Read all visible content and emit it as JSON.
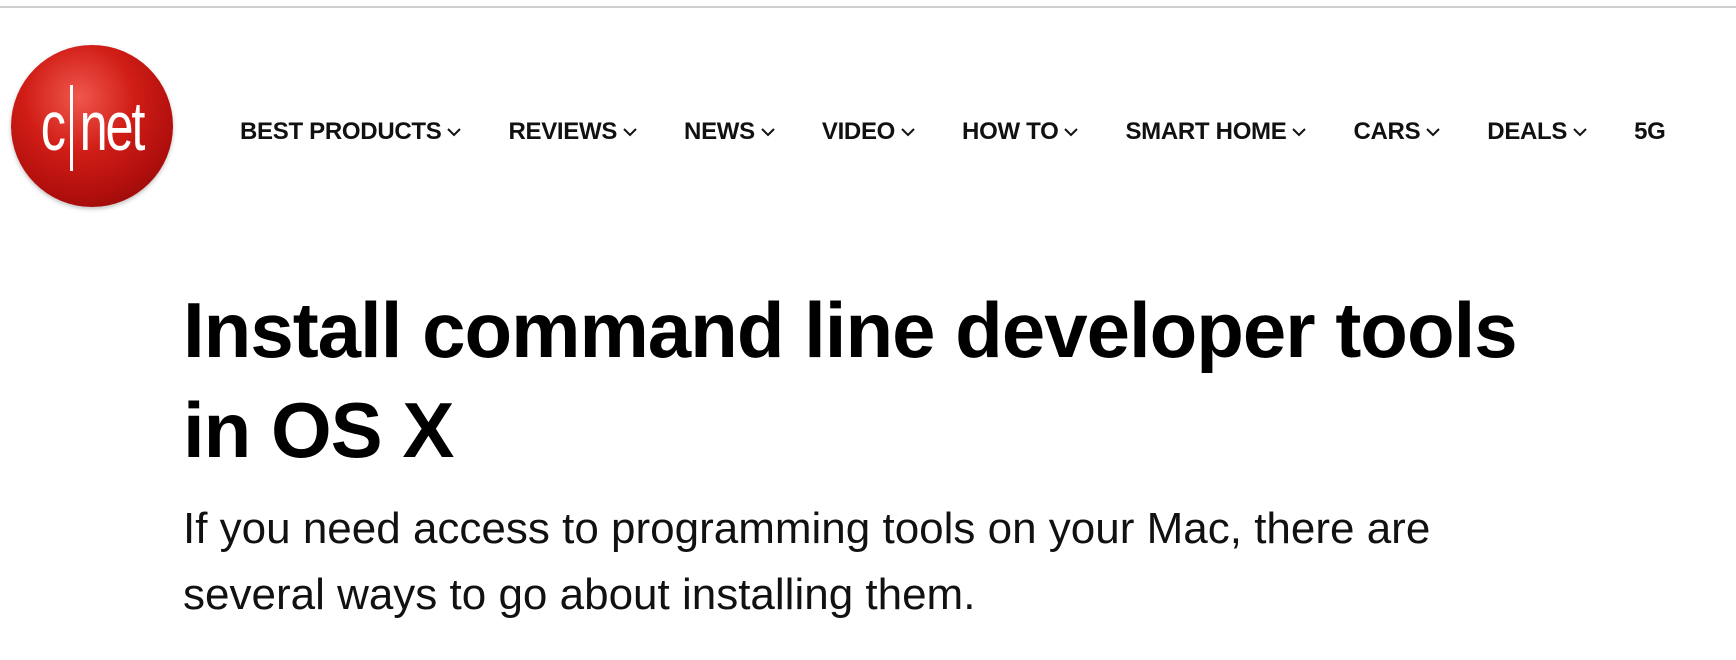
{
  "header": {
    "logo_text": "cnet",
    "logo_color": "#cc1a14",
    "nav": [
      {
        "label": "BEST PRODUCTS",
        "icon": "chevron-down-icon"
      },
      {
        "label": "REVIEWS",
        "icon": "chevron-down-icon"
      },
      {
        "label": "NEWS",
        "icon": "chevron-down-icon"
      },
      {
        "label": "VIDEO",
        "icon": "chevron-down-icon"
      },
      {
        "label": "HOW TO",
        "icon": "chevron-down-icon"
      },
      {
        "label": "SMART HOME",
        "icon": "chevron-down-icon"
      },
      {
        "label": "CARS",
        "icon": "chevron-down-icon"
      },
      {
        "label": "DEALS",
        "icon": "chevron-down-icon"
      },
      {
        "label": "5G"
      }
    ]
  },
  "article": {
    "headline": "Install command line developer tools in OS X",
    "dek": "If you need access to programming tools on your Mac, there are several ways to go about installing them."
  }
}
